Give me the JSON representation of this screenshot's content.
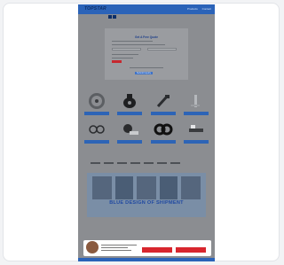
{
  "header": {
    "logo_text": "TOPSTAR",
    "nav_items": [
      "Products",
      "Contact"
    ]
  },
  "form": {
    "title": "Get A Free Quote",
    "link_label": "Submit Inquiry"
  },
  "products": [
    {
      "label": "",
      "icon": "disc-icon"
    },
    {
      "label": "",
      "icon": "bearing-icon"
    },
    {
      "label": "",
      "icon": "tool-icon"
    },
    {
      "label": "",
      "icon": "pipe-icon"
    },
    {
      "label": "",
      "icon": "fitting-icon"
    },
    {
      "label": "",
      "icon": "cable-icon"
    },
    {
      "label": "",
      "icon": "ring-icon"
    },
    {
      "label": "",
      "icon": "valve-icon"
    }
  ],
  "banner": {
    "text": "BLUE DESIGN OF SHIPMENT"
  },
  "chat": {
    "message": "",
    "buttons": [
      "",
      ""
    ]
  },
  "colors": {
    "primary": "#2b63b8",
    "accent": "#d8262e",
    "overlay": "#8b8d91"
  }
}
